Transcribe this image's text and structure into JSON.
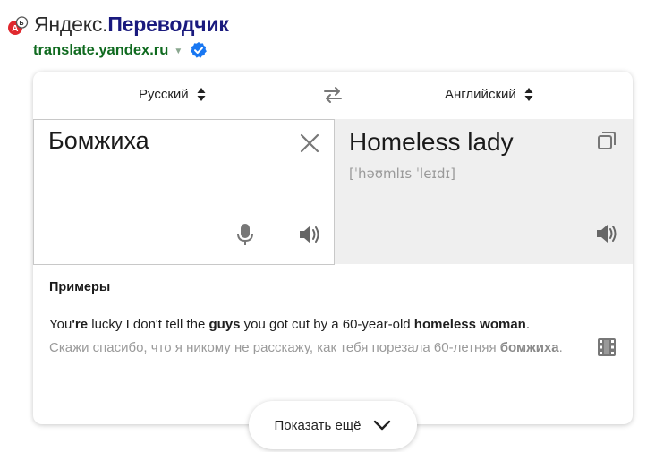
{
  "header": {
    "brand_part1": "Яндекс.",
    "brand_part2": "Переводчик",
    "url": "translate.yandex.ru",
    "url_arrow": "▼",
    "icons": [
      "translate-favicon-icon",
      "verified-badge-icon"
    ]
  },
  "langbar": {
    "source_lang": "Русский",
    "target_lang": "Английский",
    "swap_icon": "swap-arrows-icon"
  },
  "source": {
    "text": "Бомжиха",
    "icons": [
      "close-icon",
      "microphone-icon",
      "speaker-icon"
    ]
  },
  "target": {
    "text": "Homeless lady",
    "transliteration": "[ˈhəʊmlɪs ˈleɪdɪ]",
    "icons": [
      "copy-icon",
      "speaker-icon"
    ]
  },
  "examples": {
    "title": "Примеры",
    "en": [
      {
        "t": "You",
        "b": false
      },
      {
        "t": "'re",
        "b": true
      },
      {
        "t": " lucky I don't tell the ",
        "b": false
      },
      {
        "t": "guys",
        "b": true
      },
      {
        "t": " you got cut by a 60-year-old ",
        "b": false
      },
      {
        "t": "homeless woman",
        "b": true
      },
      {
        "t": ".",
        "b": false
      }
    ],
    "ru": [
      {
        "t": "Скажи спасибо, что я никому не расскажу, как тебя порезала 60-летняя ",
        "b": false
      },
      {
        "t": "бомжиха",
        "b": true
      },
      {
        "t": ".",
        "b": false
      }
    ],
    "film_icon": "film-icon"
  },
  "more_button": {
    "label": "Показать ещё",
    "icon": "chevron-down-icon"
  },
  "colors": {
    "brand_dark": "#1a1a7e",
    "url_green": "#0f6a1f",
    "verified_blue": "#1877f2",
    "favicon_red": "#e0282e",
    "target_bg": "#efefef"
  }
}
